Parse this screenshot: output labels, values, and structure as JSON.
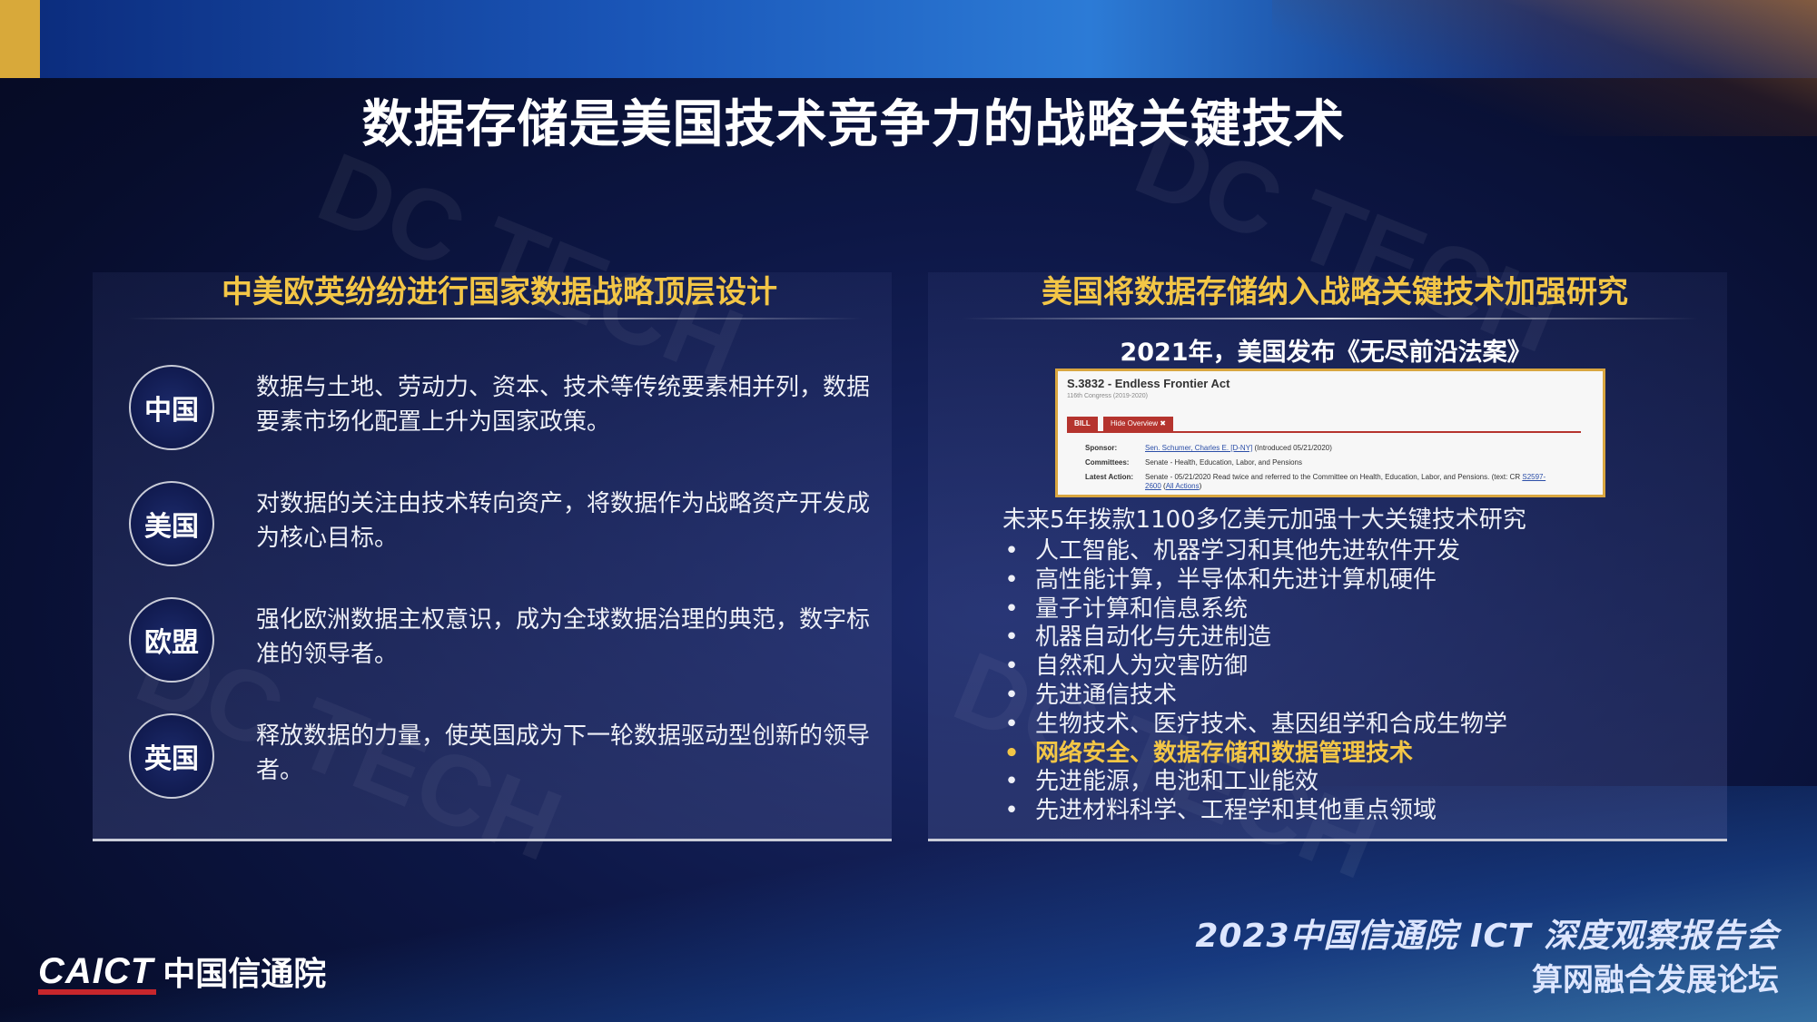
{
  "title": "数据存储是美国技术竞争力的战略关键技术",
  "left": {
    "heading": "中美欧英纷纷进行国家数据战略顶层设计",
    "countries": [
      {
        "name": "中国",
        "text": "数据与土地、劳动力、资本、技术等传统要素相并列，数据要素市场化配置上升为国家政策。"
      },
      {
        "name": "美国",
        "text": "对数据的关注由技术转向资产，将数据作为战略资产开发成为核心目标。"
      },
      {
        "name": "欧盟",
        "text": "强化欧洲数据主权意识，成为全球数据治理的典范，数字标准的领导者。"
      },
      {
        "name": "英国",
        "text": "释放数据的力量，使英国成为下一轮数据驱动型创新的领导者。"
      }
    ]
  },
  "right": {
    "heading": "美国将数据存储纳入战略关键技术加强研究",
    "caption": "2021年，美国发布《无尽前沿法案》",
    "bill": {
      "title": "S.3832 - Endless Frontier Act",
      "congress": "116th Congress (2019-2020)",
      "tab_bill": "BILL",
      "tab_hide": "Hide Overview ✖",
      "sponsor_label": "Sponsor:",
      "sponsor_link": "Sen. Schumer, Charles E. [D-NY]",
      "sponsor_rest": " (Introduced 05/21/2020)",
      "committees_label": "Committees:",
      "committees_value": "Senate - Health, Education, Labor, and Pensions",
      "action_label": "Latest Action:",
      "action_value": "Senate - 05/21/2020 Read twice and referred to the Committee on Health, Education, Labor, and Pensions. (text: CR ",
      "action_link1": "S2597-",
      "action_link2": "2600",
      "action_link3": "All Actions"
    },
    "intro": "未来5年拨款1100多亿美元加强十大关键技术研究",
    "bullet_char": "•",
    "bullets": [
      "人工智能、机器学习和其他先进软件开发",
      "高性能计算，半导体和先进计算机硬件",
      "量子计算和信息系统",
      "机器自动化与先进制造",
      "自然和人为灾害防御",
      "先进通信技术",
      "生物技术、医疗技术、基因组学和合成生物学",
      "网络安全、数据存储和数据管理技术",
      "先进能源，电池和工业能效",
      "先进材料科学、工程学和其他重点领域"
    ]
  },
  "footer": {
    "logo_en": "CAICT",
    "logo_cn": "中国信通院",
    "event_line1": "2023中国信通院 ICT 深度观察报告会",
    "event_line2": "算网融合发展论坛"
  },
  "watermark_text": "DC TECH",
  "colors": {
    "accent_yellow": "#f3c646",
    "background": "#0d1746",
    "logo_red": "#c7262c"
  }
}
